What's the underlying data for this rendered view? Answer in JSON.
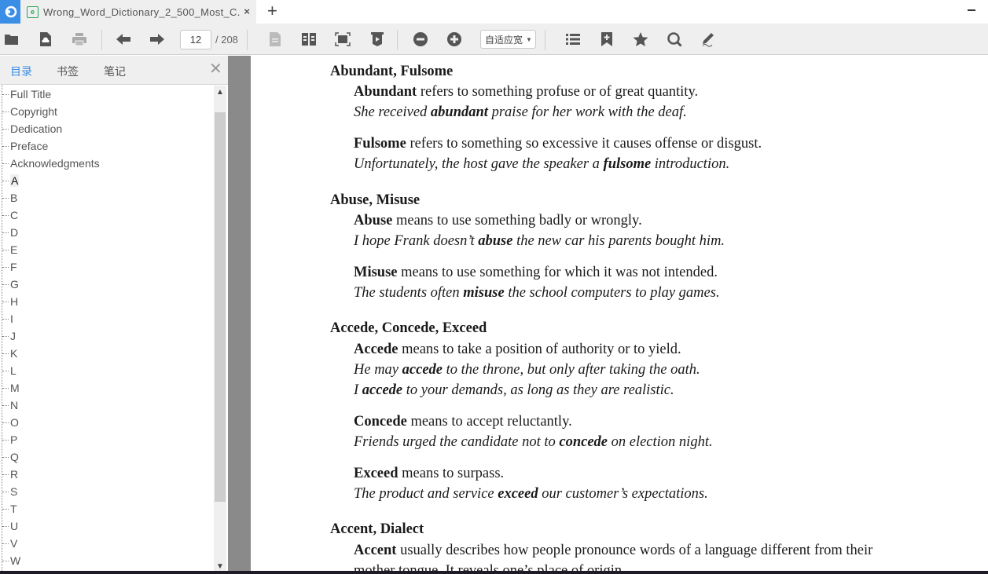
{
  "tabbar": {
    "tab_title": "Wrong_Word_Dictionary_2_500_Most_C...",
    "close_symbol": "×",
    "new_tab_symbol": "+"
  },
  "toolbar": {
    "current_page": "12",
    "total_pages": "/ 208",
    "zoom_mode": "自适应宽",
    "buttons": [
      "open-folder",
      "cloud-upload",
      "print",
      "previous-page",
      "next-page",
      "single-page-view",
      "two-page-view",
      "fullscreen",
      "presentation",
      "zoom-out",
      "zoom-in",
      "table-of-contents",
      "add-bookmark",
      "favorite",
      "search",
      "annotate"
    ]
  },
  "sidebar": {
    "tabs": [
      {
        "label": "目录",
        "active": true
      },
      {
        "label": "书签",
        "active": false
      },
      {
        "label": "笔记",
        "active": false
      }
    ],
    "close_symbol": "✕",
    "toc": [
      "Full Title",
      "Copyright",
      "Dedication",
      "Preface",
      "Acknowledgments",
      "A",
      "B",
      "C",
      "D",
      "E",
      "F",
      "G",
      "H",
      "I",
      "J",
      "K",
      "L",
      "M",
      "N",
      "O",
      "P",
      "Q",
      "R",
      "S",
      "T",
      "U",
      "V",
      "W"
    ],
    "selected": "A"
  },
  "document": {
    "entries": [
      {
        "title": "Abundant, Fulsome",
        "lines": [
          {
            "type": "def",
            "bold": "Abundant",
            "rest": " refers to something profuse or of great quantity."
          },
          {
            "type": "ex",
            "pre": "She received ",
            "bold": "abundant",
            "post": " praise for her work with the deaf."
          },
          {
            "type": "def",
            "bold": "Fulsome",
            "rest": " refers to something so excessive it causes offense or disgust."
          },
          {
            "type": "ex",
            "pre": "Unfortunately, the host gave the speaker a ",
            "bold": "fulsome",
            "post": " introduction."
          }
        ]
      },
      {
        "title": "Abuse, Misuse",
        "lines": [
          {
            "type": "def",
            "bold": "Abuse",
            "rest": " means to use something badly or wrongly."
          },
          {
            "type": "ex",
            "pre": "I hope Frank doesn’t ",
            "bold": "abuse",
            "post": " the new car his parents bought him."
          },
          {
            "type": "def",
            "bold": "Misuse",
            "rest": " means to use something for which it was not intended."
          },
          {
            "type": "ex",
            "pre": "The students often ",
            "bold": "misuse",
            "post": " the school computers to play games."
          }
        ]
      },
      {
        "title": "Accede, Concede, Exceed",
        "lines": [
          {
            "type": "def",
            "bold": "Accede",
            "rest": " means to take a position of authority or to yield."
          },
          {
            "type": "ex",
            "pre": "He may ",
            "bold": "accede",
            "post": " to the throne, but only after taking the oath."
          },
          {
            "type": "ex",
            "pre": "I ",
            "bold": "accede",
            "post": " to your demands, as long as they are realistic."
          },
          {
            "type": "def",
            "bold": "Concede",
            "rest": " means to accept reluctantly."
          },
          {
            "type": "ex",
            "pre": "Friends urged the candidate not to ",
            "bold": "concede",
            "post": " on election night."
          },
          {
            "type": "def",
            "bold": "Exceed",
            "rest": " means to surpass."
          },
          {
            "type": "ex",
            "pre": "The product and service ",
            "bold": "exceed",
            "post": " our customer’s expectations."
          }
        ]
      },
      {
        "title": "Accent, Dialect",
        "lines": [
          {
            "type": "def",
            "bold": "Accent",
            "rest": " usually describes how people pronounce words of a language different from their"
          },
          {
            "type": "plain",
            "rest": "mother tongue. It reveals one’s place of origin."
          }
        ]
      }
    ]
  },
  "colors": {
    "accent": "#3a8ee6",
    "toolbar_bg": "#efefef",
    "divider": "#8a8a8a"
  }
}
